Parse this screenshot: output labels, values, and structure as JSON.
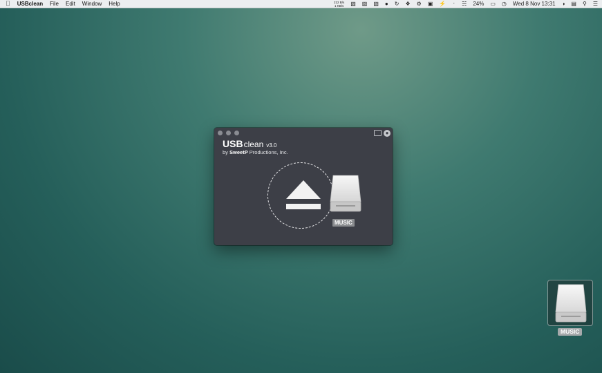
{
  "menubar": {
    "app_name": "USBclean",
    "menus": [
      "File",
      "Edit",
      "Window",
      "Help"
    ],
    "net_up": "212 B/s",
    "net_down": "1 KB/s",
    "battery": "24%",
    "datetime": "Wed 8 Nov  13:31"
  },
  "window": {
    "brand_usb": "USB",
    "brand_clean": "clean",
    "version": "v3.0",
    "by_prefix": "by ",
    "by_company": "SweetP",
    "by_suffix": " Productions, Inc.",
    "drive_label": "MUSIC"
  },
  "desktop": {
    "drive_label": "MUSIC"
  },
  "colors": {
    "window_bg": "#3d3f47",
    "menubar_bg": "#eceef0",
    "desktop_accent": "#255f5a"
  }
}
